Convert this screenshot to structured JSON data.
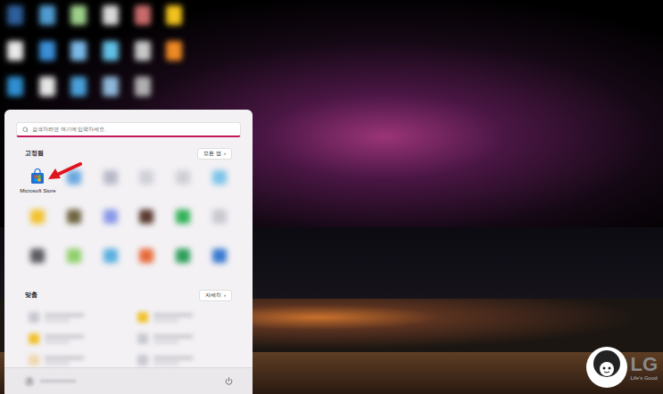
{
  "desktop_icons": [
    {
      "color": "#2d5f9a"
    },
    {
      "color": "#4f9ad0"
    },
    {
      "color": "#9ccf8a"
    },
    {
      "color": "#d8d8d8"
    },
    {
      "color": "#c86a6a"
    },
    {
      "color": "#f2c21c"
    },
    {
      "color": "#e9e9e9"
    },
    {
      "color": "#3a8fd8"
    },
    {
      "color": "#7ab8e8"
    },
    {
      "color": "#62c0e6"
    },
    {
      "color": "#c8c8c8"
    },
    {
      "color": "#f08a24"
    },
    {
      "color": "#2f8fd0"
    },
    {
      "color": "#e6e6e6"
    },
    {
      "color": "#4aa0d8"
    },
    {
      "color": "#8fb8d8"
    },
    {
      "color": "#b0b0b0"
    }
  ],
  "start_menu": {
    "search": {
      "placeholder": "검색하려면 여기에 입력하세요."
    },
    "pinned": {
      "title": "고정됨",
      "all_apps": "모든 앱",
      "chevron": "›",
      "apps": [
        {
          "label": "Microsoft Store",
          "blurred": false,
          "color": "#1f6fd6"
        },
        {
          "blurred": true,
          "color": "#6aa8e0"
        },
        {
          "blurred": true,
          "color": "#b8b8c8"
        },
        {
          "blurred": true,
          "color": "#d0d0d8"
        },
        {
          "blurred": true,
          "color": "#cfd0d6"
        },
        {
          "blurred": true,
          "color": "#7ec4ea"
        },
        {
          "blurred": true,
          "color": "#f2c230"
        },
        {
          "blurred": true,
          "color": "#6e6440"
        },
        {
          "blurred": true,
          "color": "#8a9ae8"
        },
        {
          "blurred": true,
          "color": "#5a3a30"
        },
        {
          "blurred": true,
          "color": "#34b25a"
        },
        {
          "blurred": true,
          "color": "#c8c8d0"
        },
        {
          "blurred": true,
          "color": "#5a5a60"
        },
        {
          "blurred": true,
          "color": "#8ed06a"
        },
        {
          "blurred": true,
          "color": "#5ab0e0"
        },
        {
          "blurred": true,
          "color": "#e86a3a"
        },
        {
          "blurred": true,
          "color": "#2e9e5a"
        },
        {
          "blurred": true,
          "color": "#3a7ad0"
        }
      ]
    },
    "recommended": {
      "title": "맞춤",
      "more": "자세히",
      "chevron": "›",
      "items": [
        {
          "blurred": true,
          "color": "#c8c8d0"
        },
        {
          "blurred": true,
          "color": "#f2c230"
        },
        {
          "blurred": true,
          "color": "#f2c230"
        },
        {
          "blurred": true,
          "color": "#c8c8d0"
        },
        {
          "blurred": true,
          "color": "#f0d8b0"
        },
        {
          "blurred": true,
          "color": "#c8c8d0"
        }
      ]
    }
  },
  "watermark": {
    "brand": "LG",
    "slogan": "Life's Good"
  }
}
